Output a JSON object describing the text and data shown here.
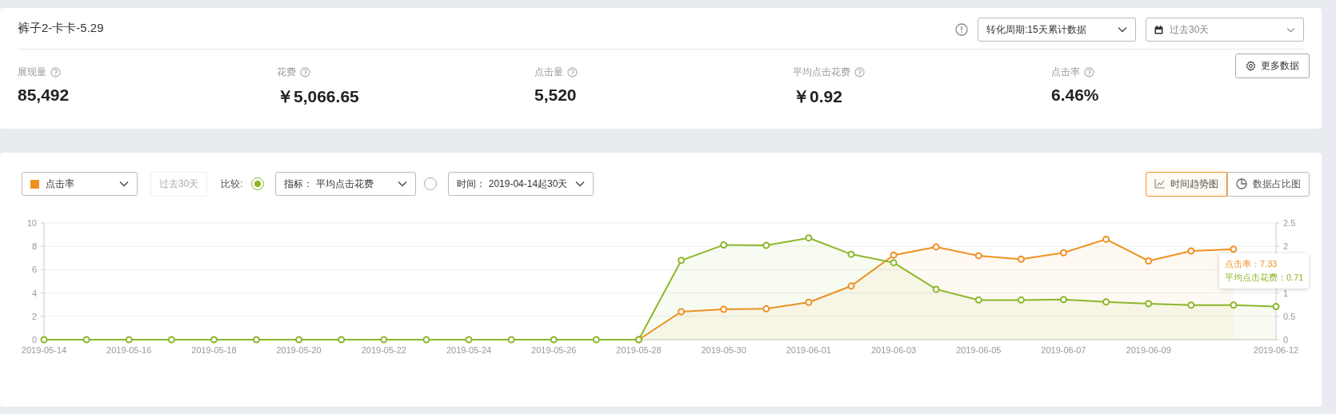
{
  "header": {
    "title": "裤子2-卡卡-5.29",
    "conversion_select": "转化周期:15天累计数据",
    "date_select": "过去30天",
    "more_button": "更多数据"
  },
  "metrics": [
    {
      "label": "展现量",
      "value": "85,492"
    },
    {
      "label": "花费",
      "value": "￥5,066.65"
    },
    {
      "label": "点击量",
      "value": "5,520"
    },
    {
      "label": "平均点击花费",
      "value": "￥0.92"
    },
    {
      "label": "点击率",
      "value": "6.46%"
    }
  ],
  "chart_panel": {
    "metric_select": "点击率",
    "period_button": {
      "label": "过去30天",
      "disabled": true
    },
    "compare_label": "比较:",
    "compare_options": [
      {
        "selected": true,
        "label": "指标：",
        "value": "平均点击花费"
      },
      {
        "selected": false,
        "label": "时间：",
        "value": "2019-04-14起30天"
      }
    ],
    "view_tabs": [
      {
        "kind": "line",
        "label": "时间趋势图",
        "selected": true
      },
      {
        "kind": "pie",
        "label": "数据占比图",
        "selected": false
      }
    ],
    "chart_data": {
      "type": "line",
      "x": [
        "2019-05-14",
        "2019-05-15",
        "2019-05-16",
        "2019-05-17",
        "2019-05-18",
        "2019-05-19",
        "2019-05-20",
        "2019-05-21",
        "2019-05-22",
        "2019-05-23",
        "2019-05-24",
        "2019-05-25",
        "2019-05-26",
        "2019-05-27",
        "2019-05-28",
        "2019-05-29",
        "2019-05-30",
        "2019-05-31",
        "2019-06-01",
        "2019-06-02",
        "2019-06-03",
        "2019-06-04",
        "2019-06-05",
        "2019-06-06",
        "2019-06-07",
        "2019-06-08",
        "2019-06-09",
        "2019-06-10",
        "2019-06-11",
        "2019-06-12"
      ],
      "xticks": [
        "2019-05-14",
        "2019-05-16",
        "2019-05-18",
        "2019-05-20",
        "2019-05-22",
        "2019-05-24",
        "2019-05-26",
        "2019-05-28",
        "2019-05-30",
        "2019-06-01",
        "2019-06-03",
        "2019-06-05",
        "2019-06-07",
        "2019-06-09",
        "2019-06-12"
      ],
      "grid": true,
      "xlim": [
        "2019-05-14",
        "2019-06-12"
      ],
      "ylim": [
        0,
        10
      ],
      "yticks": [
        0,
        2,
        4,
        6,
        8,
        10
      ],
      "y2lim": [
        0,
        2.5
      ],
      "y2ticks": [
        0,
        0.5,
        1,
        2,
        2.5
      ],
      "series": [
        {
          "color": "#ef9121",
          "marker": "circle",
          "values": [
            null,
            null,
            null,
            null,
            null,
            null,
            null,
            null,
            null,
            null,
            null,
            null,
            null,
            null,
            0,
            2.4,
            2.6,
            2.65,
            3.2,
            4.6,
            7.25,
            7.95,
            7.2,
            6.9,
            7.45,
            8.6,
            6.75,
            7.6,
            7.75,
            null
          ]
        },
        {
          "color": "#8cb72a",
          "axis": "y2",
          "marker": "circle",
          "values": [
            0,
            0,
            0,
            0,
            0,
            0,
            0,
            0,
            0,
            0,
            0,
            0,
            0,
            0,
            0,
            1.7,
            2.03,
            2.02,
            2.18,
            1.83,
            1.65,
            1.08,
            0.85,
            0.85,
            0.86,
            0.81,
            0.77,
            0.74,
            0.74,
            0.71
          ]
        }
      ]
    },
    "tooltip": [
      "点击率：7.33",
      "平均点击花费：0.71"
    ]
  }
}
